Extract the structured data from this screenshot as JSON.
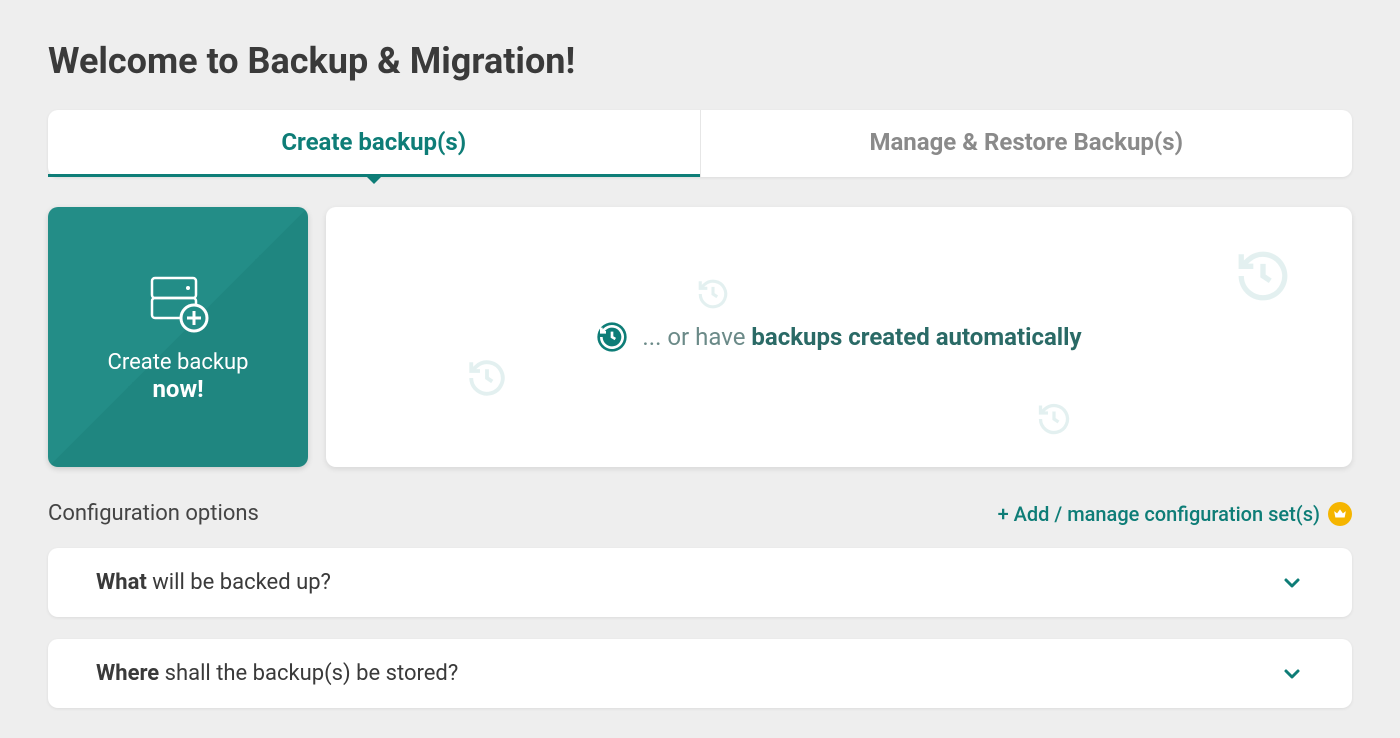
{
  "title": "Welcome to Backup & Migration!",
  "tabs": {
    "create": "Create backup(s)",
    "manage": "Manage & Restore Backup(s)"
  },
  "create_card": {
    "line1": "Create backup",
    "line2": "now!"
  },
  "auto_card": {
    "prefix": "... or have ",
    "bold": "backups created automatically"
  },
  "config": {
    "label": "Configuration options",
    "add_link": "+ Add / manage configuration set(s)"
  },
  "accordions": {
    "what": {
      "bold": "What",
      "rest": " will be backed up?"
    },
    "where": {
      "bold": "Where",
      "rest": " shall the backup(s) be stored?"
    }
  }
}
